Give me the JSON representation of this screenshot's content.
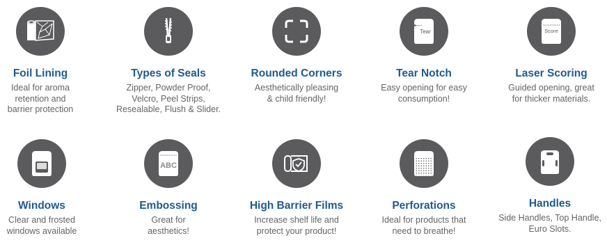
{
  "features": [
    {
      "title": "Foil Lining",
      "desc_lines": [
        "Ideal for aroma",
        "retention and",
        "barrier protection"
      ],
      "icon": "foil-roll-icon"
    },
    {
      "title": "Types of Seals",
      "desc_lines": [
        "Zipper, Powder Proof,",
        "Velcro, Peel Strips,",
        "Resealable, Flush & Slider."
      ],
      "icon": "zipper-icon"
    },
    {
      "title": "Rounded Corners",
      "desc_lines": [
        "Aesthetically pleasing",
        "& child friendly!"
      ],
      "icon": "rounded-corners-icon"
    },
    {
      "title": "Tear Notch",
      "desc_lines": [
        "Easy opening for easy",
        "consumption!"
      ],
      "icon": "tear-notch-pouch-icon",
      "icon_text": "Tear"
    },
    {
      "title": "Laser Scoring",
      "desc_lines": [
        "Guided opening, great",
        "for thicker materials."
      ],
      "icon": "laser-score-pouch-icon",
      "icon_text": "Score"
    },
    {
      "title": "Windows",
      "desc_lines": [
        "Clear and frosted",
        "windows available"
      ],
      "icon": "window-pouch-icon"
    },
    {
      "title": "Embossing",
      "desc_lines": [
        "Great for",
        "aesthetics!"
      ],
      "icon": "embossed-pouch-icon",
      "icon_text": "ABC"
    },
    {
      "title": "High Barrier Films",
      "desc_lines": [
        "Increase shelf life and",
        "protect your product!"
      ],
      "icon": "shield-film-icon"
    },
    {
      "title": "Perforations",
      "desc_lines": [
        "Ideal for products that",
        "need to breathe!"
      ],
      "icon": "perforated-pouch-icon"
    },
    {
      "title": "Handles",
      "desc_lines": [
        "Side Handles, Top Handle,",
        "Euro Slots."
      ],
      "icon": "handle-pouch-icon"
    }
  ],
  "colors": {
    "circle": "#5b5b5e",
    "title": "#1f5b8e",
    "text": "#646464"
  }
}
